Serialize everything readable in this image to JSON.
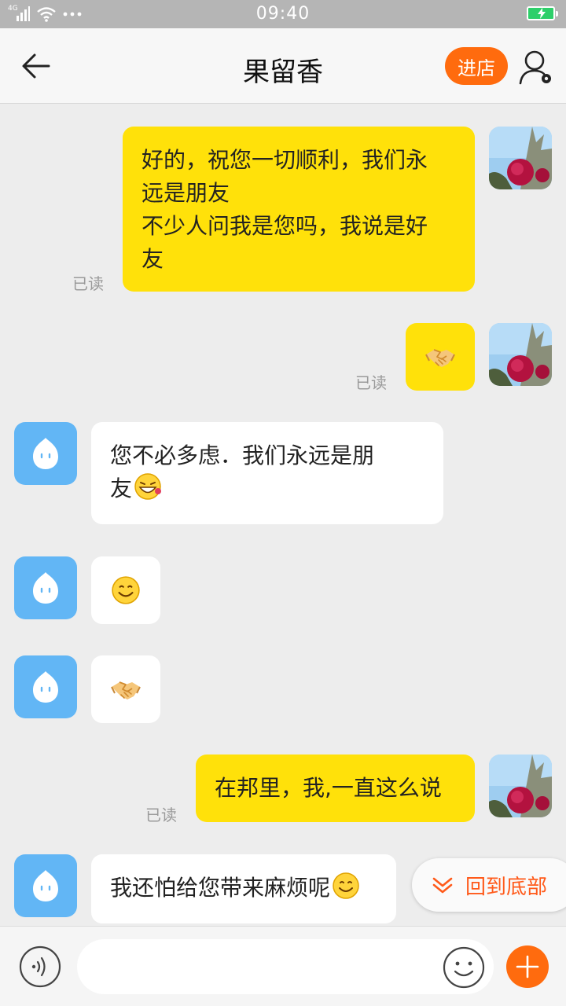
{
  "status_bar": {
    "time": "09:40",
    "network": "4G"
  },
  "header": {
    "title": "果留香",
    "shop_button": "进店"
  },
  "messages": [
    {
      "from": "me",
      "lines": [
        "好的，祝您一切顺利，我们永",
        "远是朋友",
        "不少人问我是您吗，我说是好",
        "友"
      ],
      "read": "已读"
    },
    {
      "from": "me",
      "emoji": "handshake-emoji",
      "read": "已读"
    },
    {
      "from": "other",
      "lines": [
        "您不必多虑．我们永远是朋",
        "友"
      ],
      "trailing_emoji": "laughing-emoji"
    },
    {
      "from": "other",
      "emoji": "smile-emoji"
    },
    {
      "from": "other",
      "emoji": "handshake-emoji"
    },
    {
      "from": "me",
      "lines": [
        "在邦里，我,一直这么说"
      ],
      "read": "已读"
    },
    {
      "from": "other",
      "lines": [
        "我还怕给您带来麻烦呢"
      ],
      "trailing_emoji": "smile-emoji"
    }
  ],
  "back_to_bottom": "回到底部",
  "input": {
    "value": "",
    "placeholder": ""
  },
  "colors": {
    "accent": "#ff6b0e",
    "my_bubble": "#ffe10a",
    "other_avatar": "#62b6f5",
    "battery": "#2ecf6a"
  }
}
